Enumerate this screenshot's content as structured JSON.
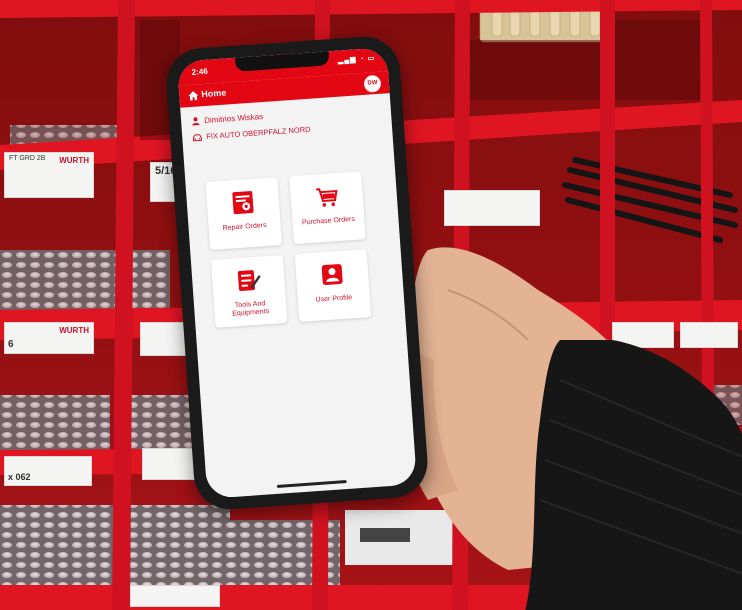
{
  "phone": {
    "status_time": "2:46",
    "nav_title": "Home",
    "avatar_initials": "DW",
    "user_name": "Dimitrios  Wiskas",
    "company_name": "FIX AUTO OBERPFALZ NORD",
    "tiles": [
      {
        "label": "Repair Orders",
        "icon": "repair-orders-icon"
      },
      {
        "label": "Purchase Orders",
        "icon": "shopping-cart-icon"
      },
      {
        "label": "Tools And Equipments",
        "icon": "tools-icon"
      },
      {
        "label": "User Profile",
        "icon": "user-profile-icon"
      }
    ]
  },
  "shelf_labels": [
    {
      "brand": "WURTH",
      "code": "FT GRD 2B",
      "size": "5/16"
    },
    {
      "brand": "WURTH",
      "code": "",
      "size": "6"
    },
    {
      "brand": "",
      "code": "",
      "size": "x 062"
    }
  ],
  "colors": {
    "brand_red": "#e30613",
    "shelf_red": "#c8102e",
    "screen_bg": "#f3f3f4",
    "case": "#1a1a1a"
  }
}
